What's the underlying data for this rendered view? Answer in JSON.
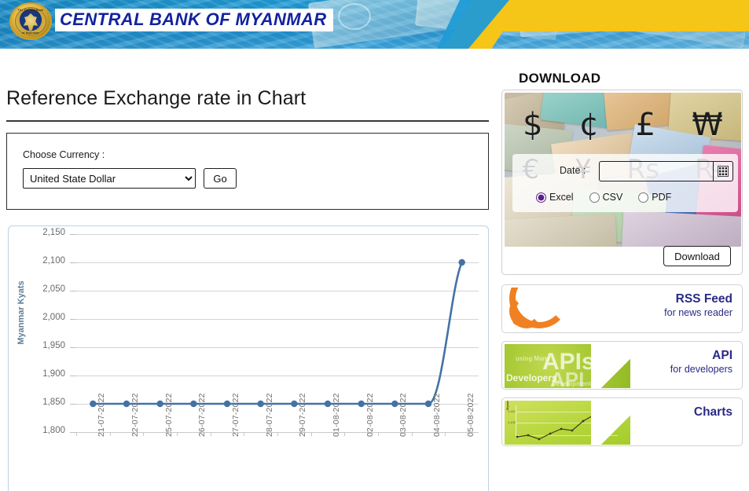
{
  "header": {
    "bank_name": "CENTRAL BANK OF MYANMAR",
    "corner_logo_label": "CENTRAL BANK OF MYANMAR",
    "seal_top_text": "The Central Bank",
    "seal_bottom_text": "of Myanmar"
  },
  "main": {
    "page_title": "Reference Exchange rate in Chart",
    "chooser": {
      "label": "Choose Currency :",
      "selected_currency": "United State Dollar",
      "options": [
        "United State Dollar"
      ],
      "go_label": "Go"
    }
  },
  "sidebar": {
    "download_heading": "DOWNLOAD",
    "date_label": "Date :",
    "date_value": "",
    "date_placeholder": "",
    "calendar_icon": "calendar-icon",
    "formats": [
      {
        "label": "Excel",
        "selected": true
      },
      {
        "label": "CSV",
        "selected": false
      },
      {
        "label": "PDF",
        "selected": false
      }
    ],
    "download_button": "Download",
    "currency_symbols_row1": [
      "$",
      "¢",
      "£",
      "₩"
    ],
    "currency_symbols_row2": [
      "€",
      "¥",
      "Rs",
      "₨"
    ],
    "promos": [
      {
        "title": "RSS Feed",
        "subtitle": "for news reader",
        "art": "rss-icon"
      },
      {
        "title": "API",
        "subtitle": "for developers",
        "art": "api-wordcloud"
      },
      {
        "title": "Charts",
        "subtitle": "",
        "art": "chart-thumbnail"
      }
    ],
    "api_art_words": [
      "APIs",
      "API",
      "Developers",
      "using Many",
      "Development"
    ]
  },
  "chart_data": {
    "type": "line",
    "title": "",
    "xlabel": "",
    "ylabel": "Myanmar Kyats",
    "ylim": [
      1800,
      2150
    ],
    "yticks": [
      1800,
      1850,
      1900,
      1950,
      2000,
      2050,
      2100,
      2150
    ],
    "ytick_labels": [
      "1,800",
      "1,850",
      "1,900",
      "1,950",
      "2,000",
      "2,050",
      "2,100",
      "2,150"
    ],
    "categories": [
      "21-07-2022",
      "22-07-2022",
      "25-07-2022",
      "26-07-2022",
      "27-07-2022",
      "28-07-2022",
      "29-07-2022",
      "01-08-2022",
      "02-08-2022",
      "03-08-2022",
      "04-08-2022",
      "05-08-2022"
    ],
    "values": [
      1850,
      1850,
      1850,
      1850,
      1850,
      1850,
      1850,
      1850,
      1850,
      1850,
      1850,
      2100
    ],
    "series": [
      {
        "name": "United State Dollar",
        "values": [
          1850,
          1850,
          1850,
          1850,
          1850,
          1850,
          1850,
          1850,
          1850,
          1850,
          1850,
          2100
        ]
      }
    ],
    "line_color": "#4472a4",
    "marker_color": "#4472a4",
    "grid": true,
    "legend": false
  }
}
